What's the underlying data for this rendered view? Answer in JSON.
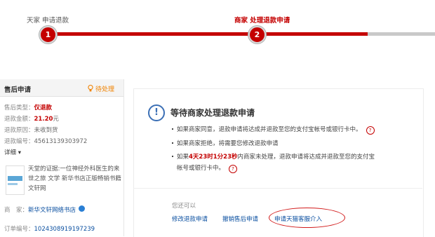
{
  "progress": {
    "step1": {
      "label": "天家 申请退款",
      "number": "1"
    },
    "step2": {
      "label": "商家 处理退款申请",
      "number": "2"
    }
  },
  "left_panel": {
    "title": "售后申请",
    "status": "待处理",
    "rows": {
      "type": {
        "k": "售后类型：",
        "v": "仅退款"
      },
      "amount": {
        "k": "退款金额：",
        "v": "21.20",
        "unit": "元"
      },
      "reason": {
        "k": "退款原因：",
        "v": "未收到货"
      },
      "number": {
        "k": "退款编号：",
        "v": "45613139303972"
      }
    },
    "detail": "详细 ▾",
    "product_title": "天堂的证据:一位神经外科医生的来世之旅 文学 新华书店正版畅销书籍 文轩网",
    "shop": {
      "k": "商　家：",
      "v": "新华文轩网络书店"
    },
    "order": {
      "k": "订单编号：",
      "v": "1024308919197239"
    }
  },
  "card": {
    "title": "等待商家处理退款申请",
    "bullet1": "如果商家同意，退款申请将达成并退款至您的支付宝帐号或银行卡中。",
    "bullet2": "如果商家拒绝，将需要您修改退款申请",
    "bullet3_prefix": "如果",
    "timer": "4天23时1分23秒",
    "bullet3_rest1": "内商家未处理，退款申请将达成并退款至您的支付宝",
    "bullet3_rest2": "帐号或银行卡中。",
    "also_can": "您还可以",
    "actions": {
      "modify": "修改退款申请",
      "cancel": "撤销售后申请",
      "request_tmall": "申请天猫客服介入"
    }
  },
  "colors": {
    "accent": "#c40000",
    "link": "#0a4fa0",
    "pending": "#f08200",
    "oval": "#d21b1b"
  }
}
